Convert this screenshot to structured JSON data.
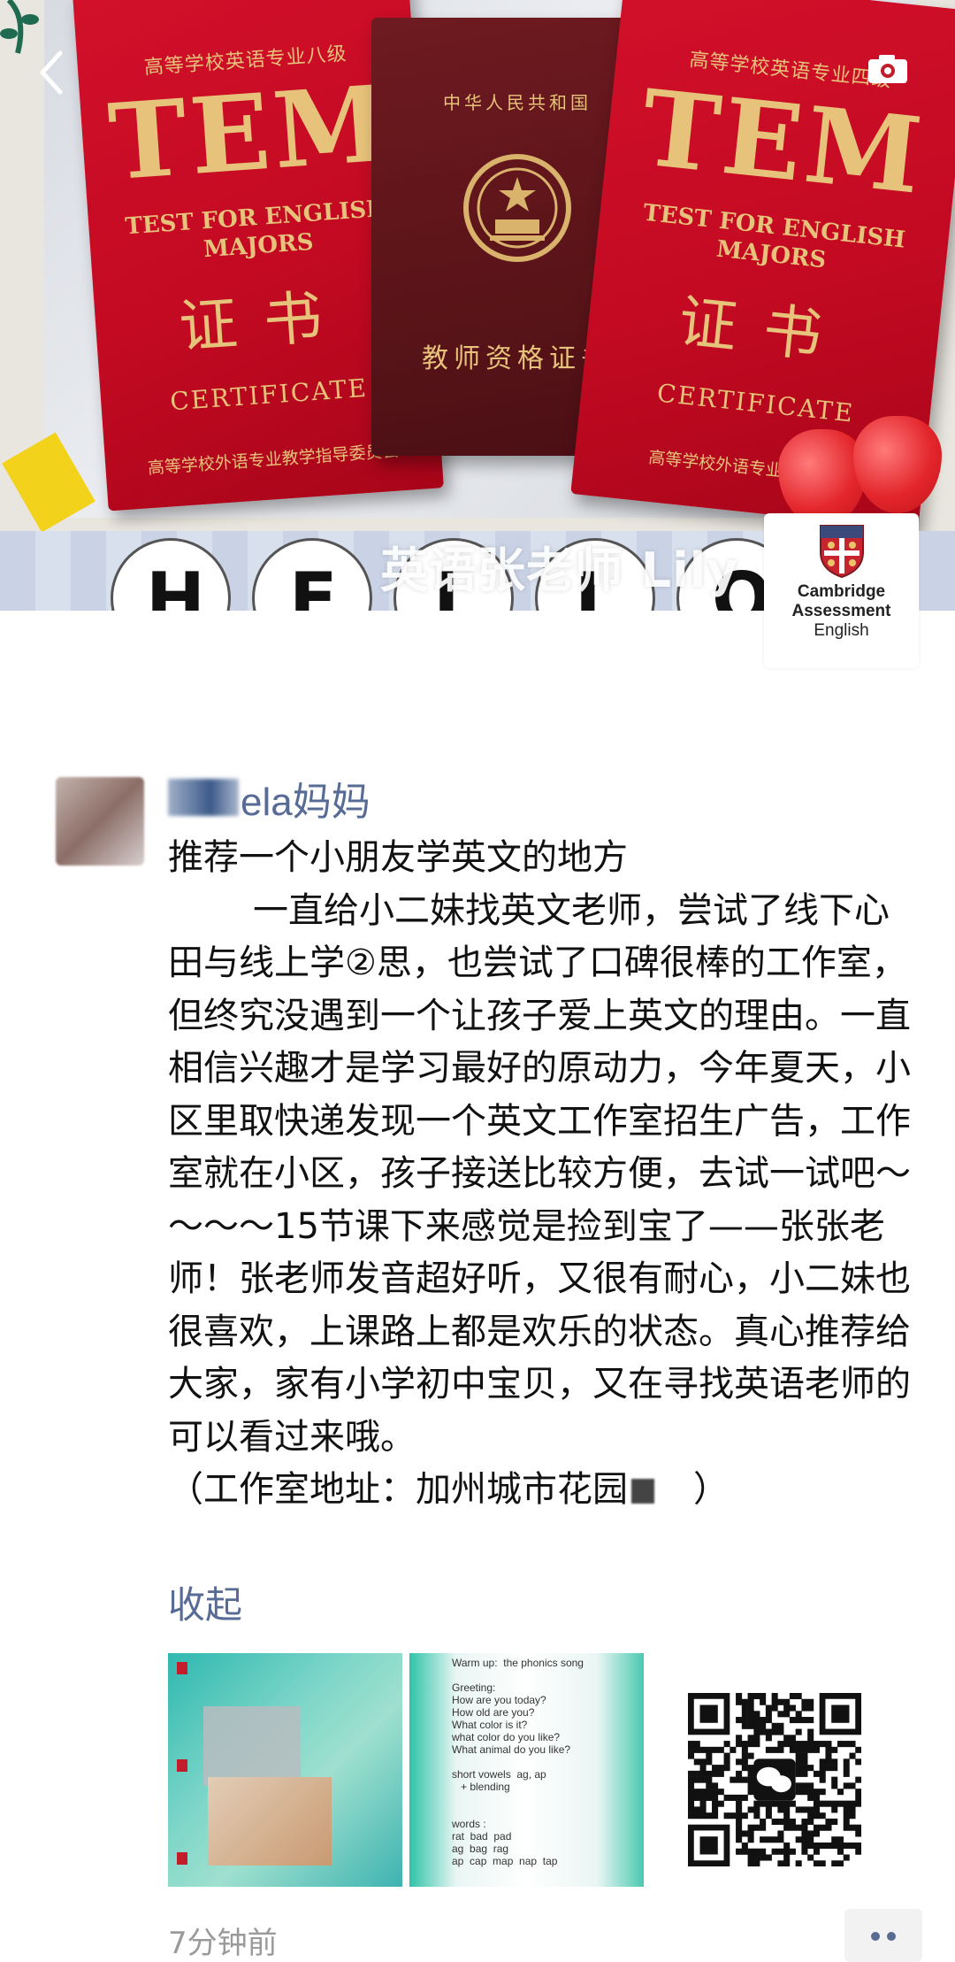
{
  "cover": {
    "cert_left": {
      "top_line": "高等学校英语专业八级",
      "title": "TEM",
      "subtitle": "TEST FOR ENGLISH",
      "subtitle2": "MAJORS",
      "zh": "证书",
      "en": "CERTIFICATE",
      "issuer": "高等学校外语专业教学指导委员会"
    },
    "cert_middle": {
      "top_line": "中华人民共和国",
      "title": "教师资格证书"
    },
    "cert_right": {
      "top_line": "高等学校英语专业四级",
      "title": "TEM",
      "subtitle": "TEST FOR ENGLISH",
      "subtitle2": "MAJORS",
      "zh": "证书",
      "en": "CERTIFICATE",
      "issuer": "高等学校外语专业教学指导"
    },
    "banner_letters": [
      "H",
      "E",
      "L",
      "L",
      "O"
    ],
    "caption": "英语张老师 Lily",
    "logo_lines": [
      "Cambridge",
      "Assessment",
      "English"
    ]
  },
  "post": {
    "author": "ela妈妈",
    "title": "推荐一个小朋友学英文的地方",
    "body": "一直给小二妹找英文老师，尝试了线下心田与线上学②思，也尝试了口碑很棒的工作室，但终究没遇到一个让孩子爱上英文的理由。一直相信兴趣才是学习最好的原动力，今年夏天，小区里取快递发现一个英文工作室招生广告，工作室就在小区，孩子接送比较方便，去试一试吧～～～～15节课下来感觉是捡到宝了——张张老师！张老师发音超好听，又很有耐心，小二妹也很喜欢，上课路上都是欢乐的状态。真心推荐给大家，家有小学初中宝贝，又在寻找英语老师的可以看过来哦。",
    "address": "（工作室地址：加州城市花园",
    "address_end": "）",
    "collapse": "收起",
    "timestamp": "7分钟前"
  },
  "thumb2_lines": [
    "Warm up:  the phonics song",
    "",
    "Greeting:",
    "How are you today?",
    "How old are you?",
    "What color is it?",
    "what color do you like?",
    "What animal do you like?",
    "",
    "short vowels  ag, ap",
    "   + blending",
    "",
    "",
    "words :",
    "rat  bad  pad",
    "ag  bag  rag",
    "ap  cap  map  nap  tap"
  ],
  "colors": {
    "link": "#576b95",
    "tem_red": "#c30a22",
    "gold": "#e7c27a"
  },
  "icons": [
    "camera-icon",
    "back-chevron-icon",
    "more-dots-icon",
    "wechat-icon"
  ]
}
